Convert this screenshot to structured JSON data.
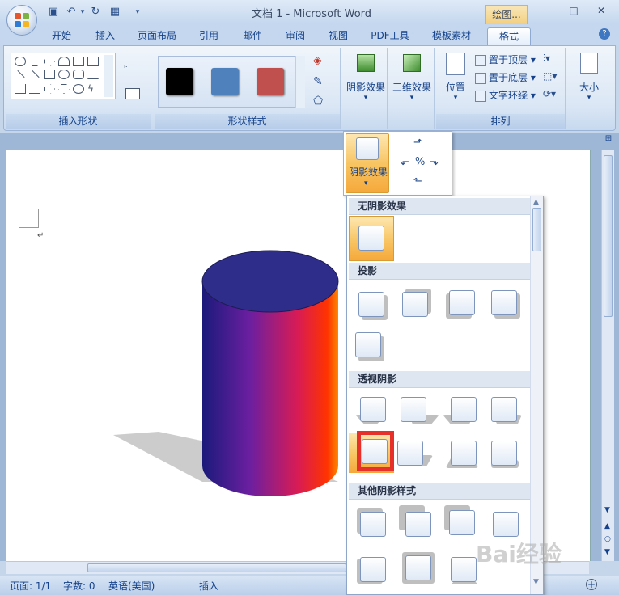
{
  "window": {
    "title": "文档 1 - Microsoft Word",
    "context_tab_label": "绘图...",
    "minimize": "—",
    "maximize": "□",
    "close": "✕"
  },
  "tabs": [
    "开始",
    "插入",
    "页面布局",
    "引用",
    "邮件",
    "审阅",
    "视图",
    "PDF工具",
    "模板素材",
    "格式"
  ],
  "active_tab": "格式",
  "ribbon": {
    "groups": {
      "insert_shapes": "插入形状",
      "shape_styles": "形状样式",
      "arrange": "排列"
    },
    "buttons": {
      "shadow_effects": "阴影效果",
      "threed_effects": "三维效果",
      "position": "位置",
      "bring_to_front": "置于顶层",
      "send_to_back": "置于底层",
      "text_wrapping": "文字环绕",
      "size": "大小"
    },
    "style_swatches": [
      {
        "color": "#000000"
      },
      {
        "color": "#4f81bd"
      },
      {
        "color": "#c0504d"
      }
    ]
  },
  "shadow_popup_label": "阴影效果",
  "shadow_gallery": {
    "sections": [
      {
        "title": "无阴影效果"
      },
      {
        "title": "投影"
      },
      {
        "title": "透视阴影"
      },
      {
        "title": "其他阴影样式"
      }
    ],
    "selected_item": "透视阴影-row2-col1"
  },
  "cylinder": {
    "top_color": "#2e2e8a",
    "gradient": [
      "#1a1a7a",
      "#6b1fa0",
      "#d81b55",
      "#ff3300",
      "#ff8800"
    ],
    "shadow_color": "#cccccc"
  },
  "status": {
    "page": "页面: 1/1",
    "words": "字数: 0",
    "language": "英语(美国)",
    "mode": "插入"
  },
  "watermark": "Bai经验",
  "colors": {
    "ribbon_bg": "#dbe7f5",
    "accent_orange": "#f8c563",
    "highlight_red": "#e8302a"
  }
}
